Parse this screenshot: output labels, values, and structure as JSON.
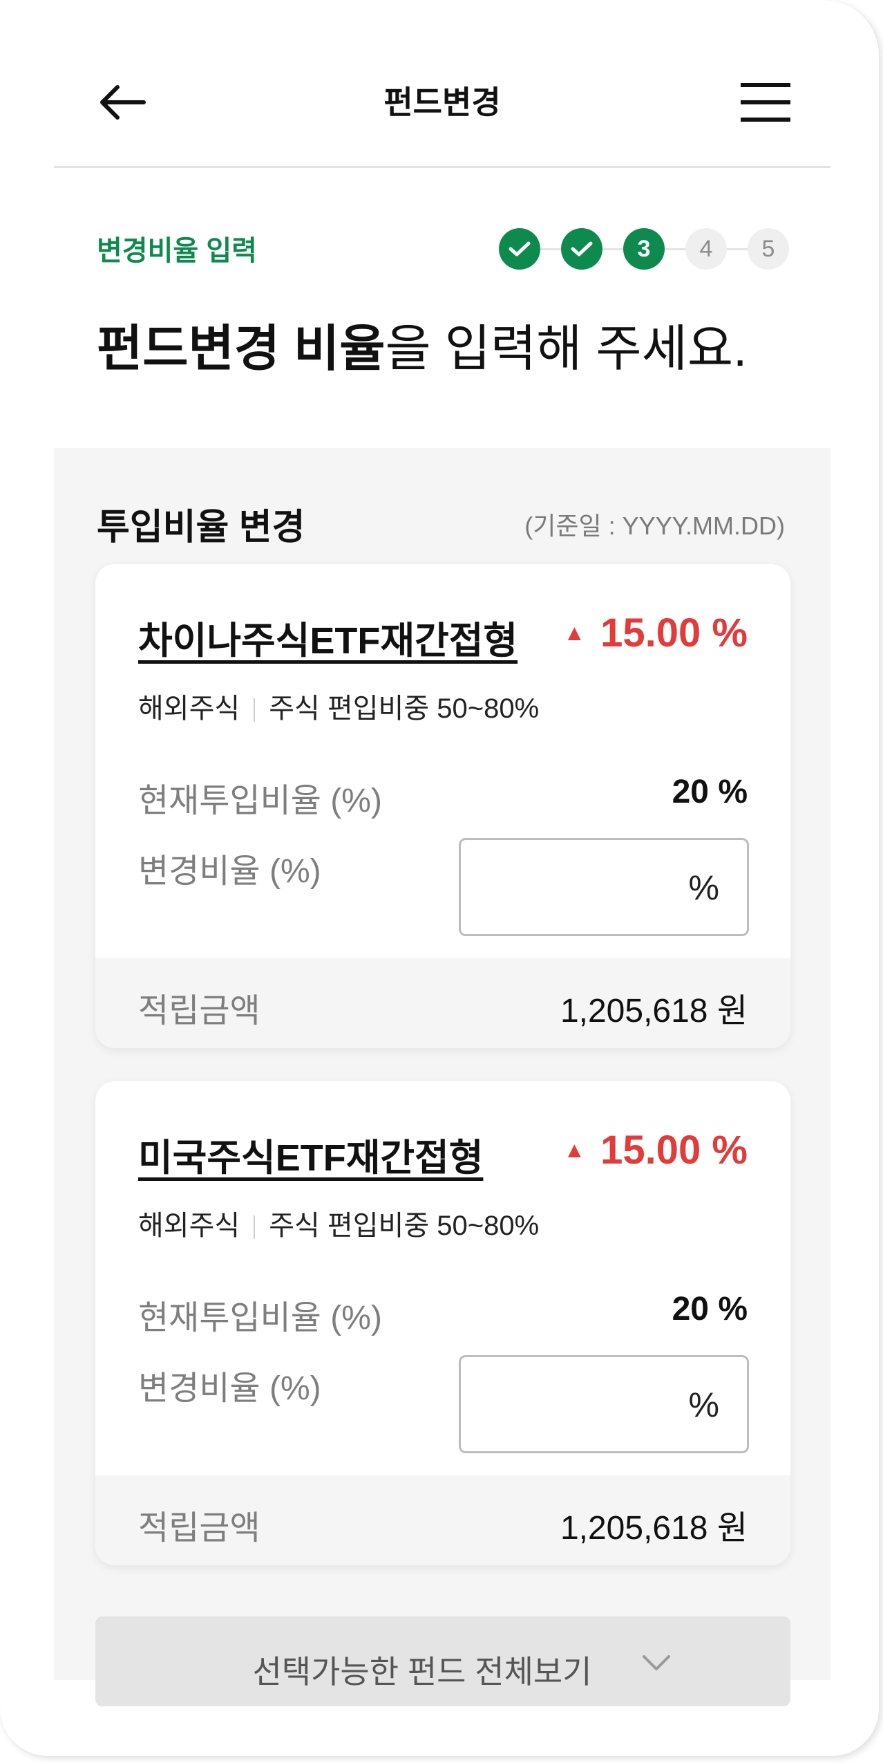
{
  "header": {
    "title": "펀드변경"
  },
  "step": {
    "label": "변경비율 입력",
    "steps": [
      "",
      "",
      "3",
      "4",
      "5"
    ]
  },
  "heading": {
    "bold": "펀드변경 비율",
    "rest": "을 입력해 주세요."
  },
  "section": {
    "title": "투입비율 변경",
    "base_date": "(기준일 : YYYY.MM.DD)"
  },
  "funds": [
    {
      "name": "차이나주식ETF재간접형",
      "rate": "15.00 %",
      "tag1": "해외주식",
      "tag2": "주식 편입비중 50~80%",
      "current_label": "현재투입비율 (%)",
      "current_value": "20 %",
      "change_label": "변경비율 (%)",
      "change_value": "",
      "change_unit": "%",
      "amount_label": "적립금액",
      "amount_value": "1,205,618 원"
    },
    {
      "name": "미국주식ETF재간접형",
      "rate": "15.00 %",
      "tag1": "해외주식",
      "tag2": "주식 편입비중 50~80%",
      "current_label": "현재투입비율 (%)",
      "current_value": "20 %",
      "change_label": "변경비율 (%)",
      "change_value": "",
      "change_unit": "%",
      "amount_label": "적립금액",
      "amount_value": "1,205,618 원"
    }
  ],
  "view_all": {
    "label": "선택가능한 펀드 전체보기"
  },
  "colors": {
    "accent": "#0f8a4e",
    "up": "#e33a3a"
  }
}
